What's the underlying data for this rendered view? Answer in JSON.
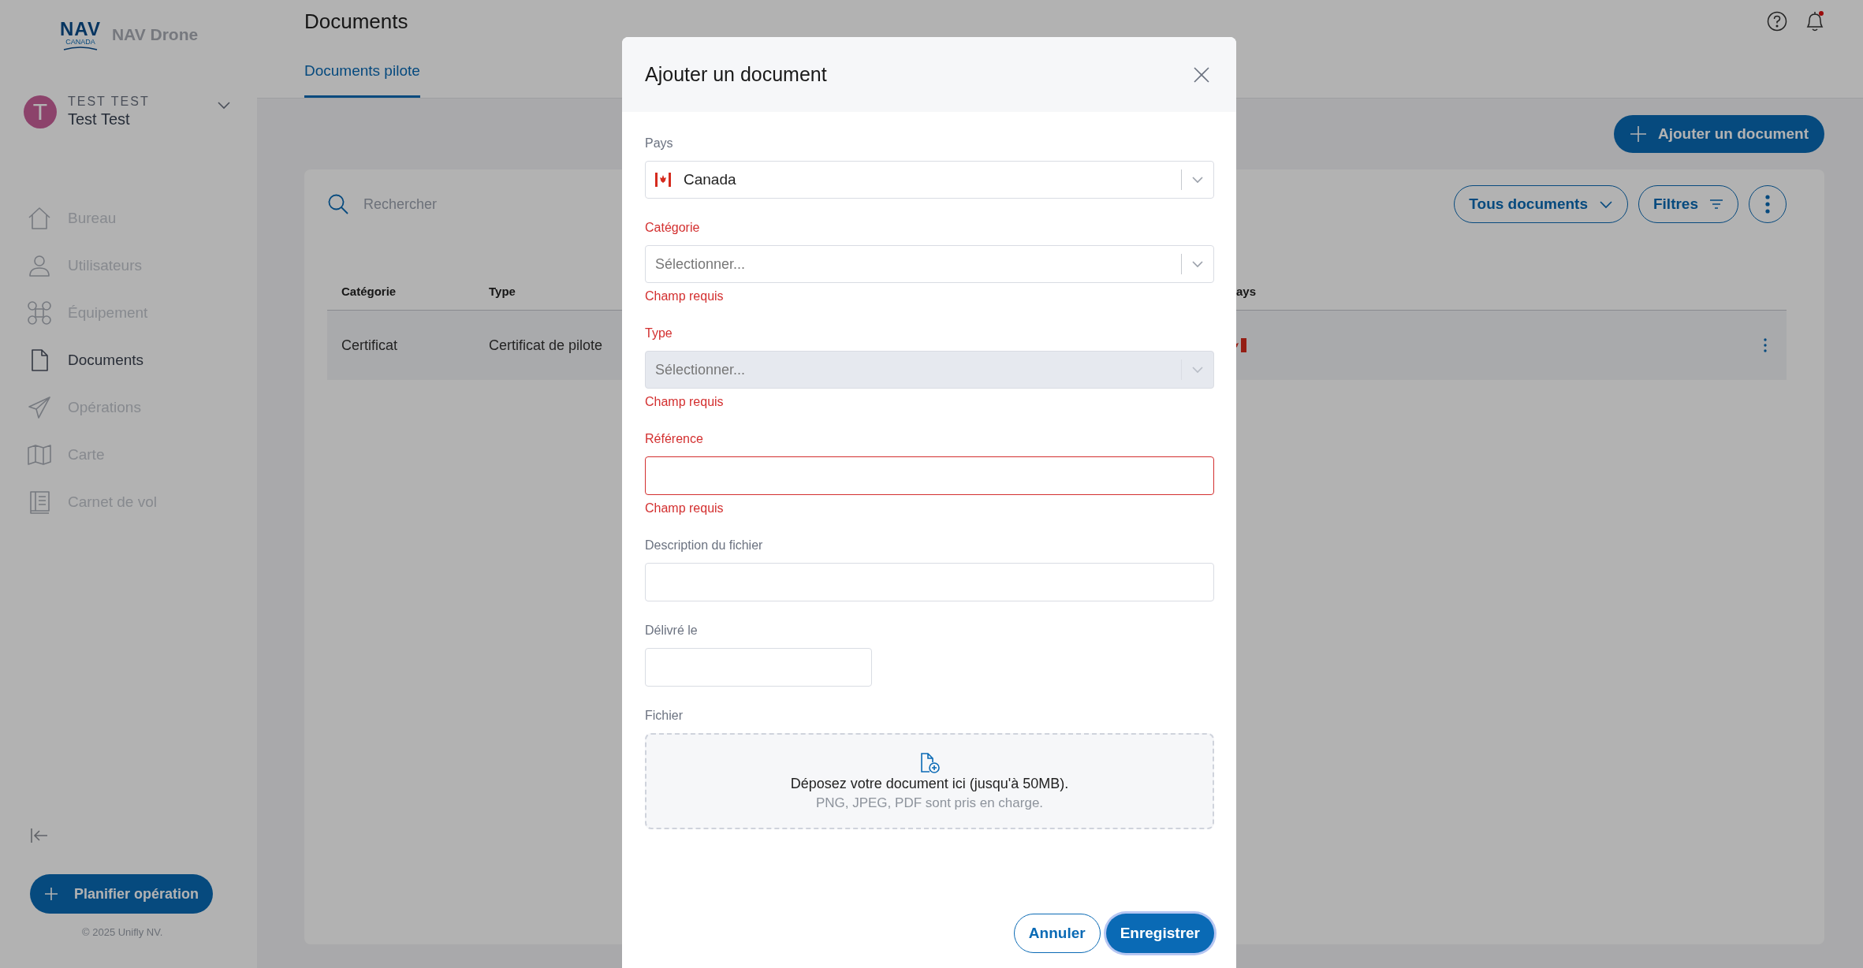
{
  "app": {
    "logo_text": "NAV",
    "logo_subtext": "CANADA",
    "name": "NAV Drone"
  },
  "user": {
    "initial": "T",
    "handle": "TEST TEST",
    "name": "Test Test"
  },
  "sidebar": {
    "items": [
      {
        "label": "Bureau",
        "selected": false
      },
      {
        "label": "Utilisateurs",
        "selected": false
      },
      {
        "label": "Équipement",
        "selected": false
      },
      {
        "label": "Documents",
        "selected": true
      },
      {
        "label": "Opérations",
        "selected": false
      },
      {
        "label": "Carte",
        "selected": false
      },
      {
        "label": "Carnet de vol",
        "selected": false
      }
    ],
    "primary_action": "Planifier opération",
    "copyright": "© 2025 Unifly NV."
  },
  "page": {
    "title": "Documents",
    "tabs": [
      {
        "label": "Documents pilote",
        "selected": true
      }
    ],
    "add_button": "Ajouter un document",
    "has_notifications": true
  },
  "toolbar": {
    "search_placeholder": "Rechercher",
    "view_dropdown": "Tous documents",
    "filters_button": "Filtres"
  },
  "table": {
    "columns": [
      "Catégorie",
      "Type",
      "ays"
    ],
    "rows": [
      {
        "cells": [
          "Certificat",
          "Certificat de pilote"
        ]
      }
    ]
  },
  "modal": {
    "title": "Ajouter un document",
    "fields": [
      {
        "kind": "country",
        "label": "Pays",
        "value": "Canada",
        "invalid": false
      },
      {
        "kind": "select",
        "label": "Catégorie",
        "placeholder": "Sélectionner...",
        "error": "Champ requis",
        "invalid": true
      },
      {
        "kind": "select",
        "label": "Type",
        "placeholder": "Sélectionner...",
        "error": "Champ requis",
        "invalid": true,
        "disabled": true
      },
      {
        "kind": "input",
        "label": "Référence",
        "error": "Champ requis",
        "invalid": true
      },
      {
        "kind": "input",
        "label": "Description du fichier",
        "invalid": false
      },
      {
        "kind": "date",
        "label": "Délivré le",
        "invalid": false
      }
    ],
    "file": {
      "label": "Fichier",
      "drop_text": "Déposez votre document ici (jusqu'à 50MB).",
      "hint": "PNG, JPEG, PDF sont pris en charge."
    },
    "cancel_button": "Annuler",
    "save_button": "Enregistrer"
  }
}
